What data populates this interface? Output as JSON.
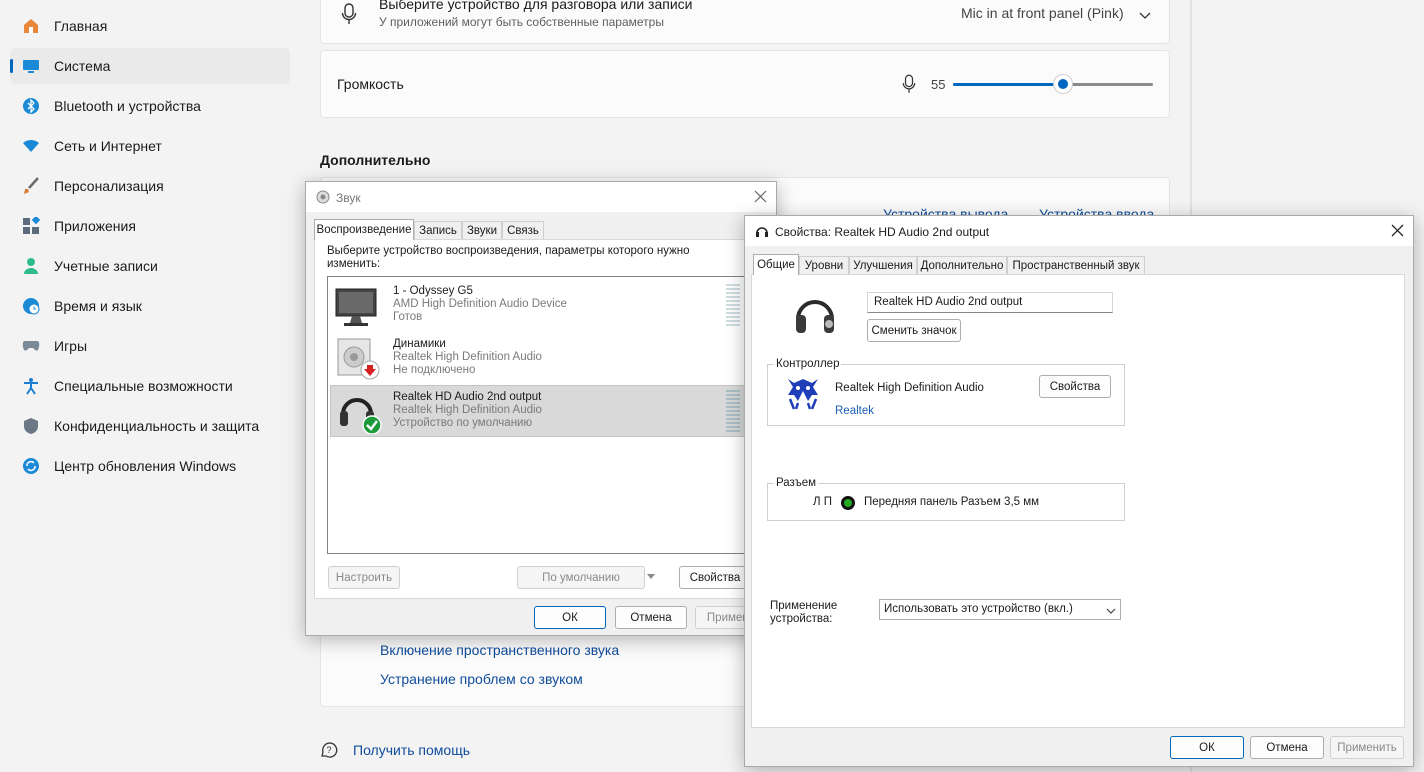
{
  "sidebar": {
    "items": [
      {
        "label": "Главная",
        "icon": "home-icon",
        "color": "#e8873a"
      },
      {
        "label": "Система",
        "icon": "system-icon",
        "color": "#1a8ad6"
      },
      {
        "label": "Bluetooth и устройства",
        "icon": "bluetooth-icon",
        "color": "#1a8ad6"
      },
      {
        "label": "Сеть и Интернет",
        "icon": "wifi-icon",
        "color": "#1a8ad6"
      },
      {
        "label": "Персонализация",
        "icon": "brush-icon",
        "color": "#d77b3b"
      },
      {
        "label": "Приложения",
        "icon": "apps-icon",
        "color": "#5a6b7c"
      },
      {
        "label": "Учетные записи",
        "icon": "account-icon",
        "color": "#2ebc8a"
      },
      {
        "label": "Время и язык",
        "icon": "globe-clock-icon",
        "color": "#1a8ad6"
      },
      {
        "label": "Игры",
        "icon": "gamepad-icon",
        "color": "#7a8a99"
      },
      {
        "label": "Специальные возможности",
        "icon": "accessibility-icon",
        "color": "#1a7fd4"
      },
      {
        "label": "Конфиденциальность и защита",
        "icon": "shield-icon",
        "color": "#6b7785"
      },
      {
        "label": "Центр обновления Windows",
        "icon": "update-icon",
        "color": "#1a8ad6"
      }
    ],
    "active_index": 1
  },
  "content": {
    "input_select": {
      "title": "Выберите устройство для разговора или записи",
      "subtitle": "У приложений могут быть собственные параметры",
      "value": "Mic in at front panel (Pink)"
    },
    "volume": {
      "label": "Громкость",
      "value_text": "55",
      "value": 55
    },
    "advanced_header": "Дополнительно",
    "links_row": {
      "output": "Устройства вывода",
      "input": "Устройства ввода"
    },
    "spatial_link": "Включение пространственного звука",
    "troubleshoot_link": "Устранение проблем со звуком",
    "help_link": "Получить помощь"
  },
  "sound_dialog": {
    "title": "Звук",
    "tabs": [
      "Воспроизведение",
      "Запись",
      "Звуки",
      "Связь"
    ],
    "instruction": "Выберите устройство воспроизведения, параметры которого нужно изменить:",
    "devices": [
      {
        "name": "1 - Odyssey G5",
        "driver": "AMD High Definition Audio Device",
        "status": "Готов",
        "icon": "monitor-icon",
        "selected": false
      },
      {
        "name": "Динамики",
        "driver": "Realtek High Definition Audio",
        "status": "Не подключено",
        "icon": "speaker-icon",
        "selected": false
      },
      {
        "name": "Realtek HD Audio 2nd output",
        "driver": "Realtek High Definition Audio",
        "status": "Устройство по умолчанию",
        "icon": "headphones-icon",
        "selected": true
      }
    ],
    "buttons": {
      "configure": "Настроить",
      "default": "По умолчанию",
      "properties": "Свойства",
      "ok": "ОК",
      "cancel": "Отмена",
      "apply": "Примени"
    }
  },
  "props_dialog": {
    "title": "Свойства: Realtek HD Audio 2nd output",
    "tabs": [
      "Общие",
      "Уровни",
      "Улучшения",
      "Дополнительно",
      "Пространственный звук"
    ],
    "device_name": "Realtek HD Audio 2nd output",
    "change_icon": "Сменить значок",
    "controller_label": "Контроллер",
    "controller_name": "Realtek High Definition Audio",
    "controller_link": "Realtek",
    "controller_props": "Свойства",
    "jack_label": "Разъем",
    "jack_channels": "Л П",
    "jack_desc": "Передняя панель Разъем 3,5 мм",
    "jack_color": "#22aa22",
    "usage_label": "Применение устройства:",
    "usage_value": "Использовать это устройство (вкл.)",
    "buttons": {
      "ok": "ОК",
      "cancel": "Отмена",
      "apply": "Применить"
    }
  }
}
